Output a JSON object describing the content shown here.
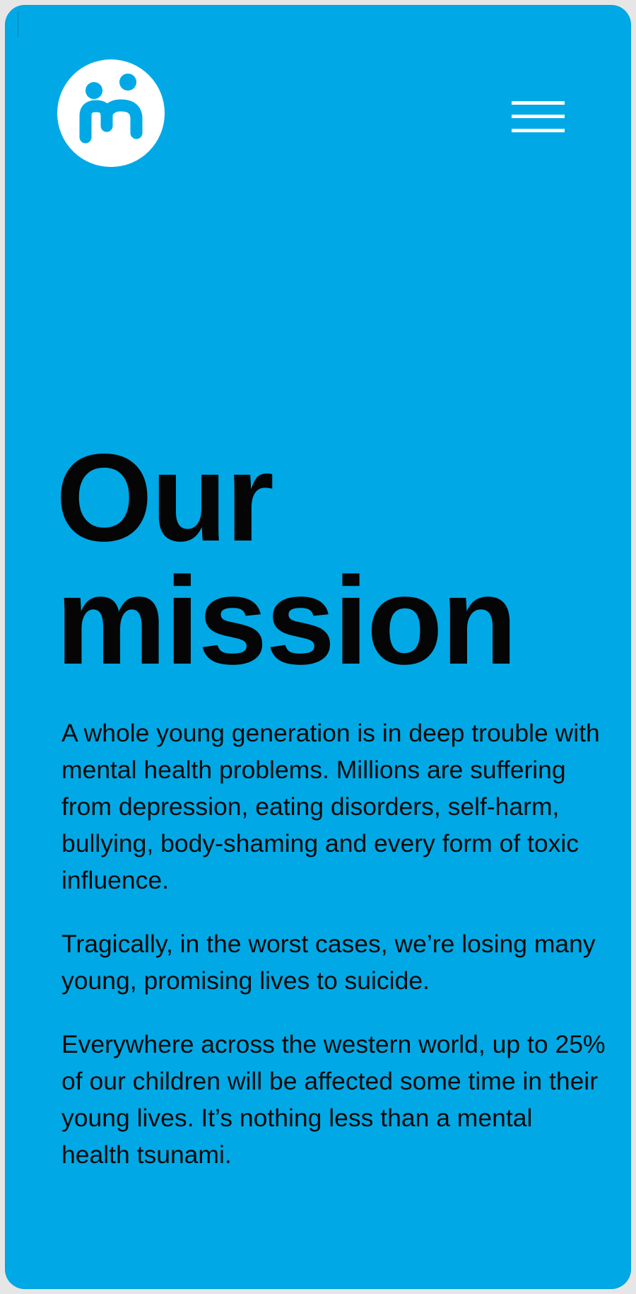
{
  "header": {
    "logo": {
      "icon": "two-people-logo-icon",
      "color": "#ffffff",
      "accent": "#00a9e6"
    },
    "menu": {
      "icon": "hamburger-menu-icon"
    }
  },
  "hero": {
    "title_line1": "Our",
    "title_line2": "mission"
  },
  "content": {
    "paragraphs": [
      "A whole young generation is in deep trouble with mental health problems. Millions are suffering from depression, eating disorders, self-harm, bullying, body-shaming and every form of toxic influence.",
      "Tragically, in the worst cases, we’re losing many young, promising lives to suicide.",
      "Everywhere across the western world, up to 25% of our children will be affected some time in their young lives. It’s nothing less than a mental health tsunami."
    ]
  },
  "colors": {
    "background": "#00a9e6",
    "text": "#050505",
    "page_border": "#e6e6e6"
  }
}
